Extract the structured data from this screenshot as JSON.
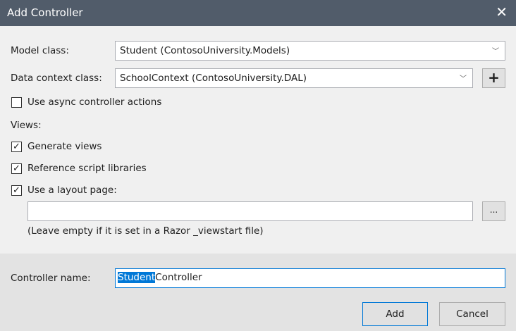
{
  "window": {
    "title": "Add Controller"
  },
  "model_class": {
    "label": "Model class:",
    "value": "Student (ContosoUniversity.Models)"
  },
  "data_context": {
    "label": "Data context class:",
    "value": "SchoolContext (ContosoUniversity.DAL)",
    "add_label": "+"
  },
  "async": {
    "label": "Use async controller actions",
    "checked": false
  },
  "views": {
    "heading": "Views:",
    "generate": {
      "label": "Generate views",
      "checked": true
    },
    "scripts": {
      "label": "Reference script libraries",
      "checked": true
    },
    "layout": {
      "label": "Use a layout page:",
      "checked": true,
      "value": "",
      "browse_label": "...",
      "hint": "(Leave empty if it is set in a Razor _viewstart file)"
    }
  },
  "controller": {
    "label": "Controller name:",
    "selected": "Student",
    "rest": "Controller"
  },
  "buttons": {
    "add": "Add",
    "cancel": "Cancel"
  }
}
